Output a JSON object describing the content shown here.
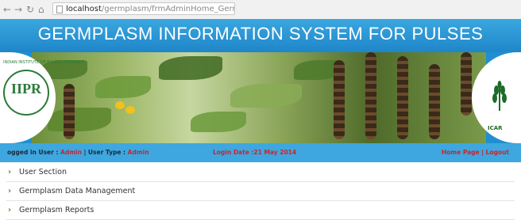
{
  "browser": {
    "url_host": "localhost",
    "url_path": "/germplasm/frmAdminHome_Germplasm.aspx",
    "back_icon": "back-arrow-icon",
    "forward_icon": "forward-arrow-icon",
    "reload_icon": "reload-icon",
    "home_icon": "home-icon"
  },
  "header": {
    "title": "GERMPLASM INFORMATION SYSTEM FOR PULSES",
    "left_logo_text": "IIPR",
    "left_logo_ring": "INDIAN INSTITUTE OF PULSES RESEARCH",
    "right_logo_text": "ICAR",
    "accent_color": "#2e9ad6"
  },
  "status": {
    "logged_in_label": "ogged in User : ",
    "logged_in_value": "Admin",
    "separator": " | ",
    "user_type_label": "User Type : ",
    "user_type_value": "Admin",
    "login_date": "Login Date :21 May 2014",
    "home_link": "Home Page",
    "link_separator": " | ",
    "logout_link": "Logout"
  },
  "menu": {
    "items": [
      {
        "label": "User Section"
      },
      {
        "label": "Germplasm Data Management"
      },
      {
        "label": "Germplasm Reports"
      }
    ]
  }
}
